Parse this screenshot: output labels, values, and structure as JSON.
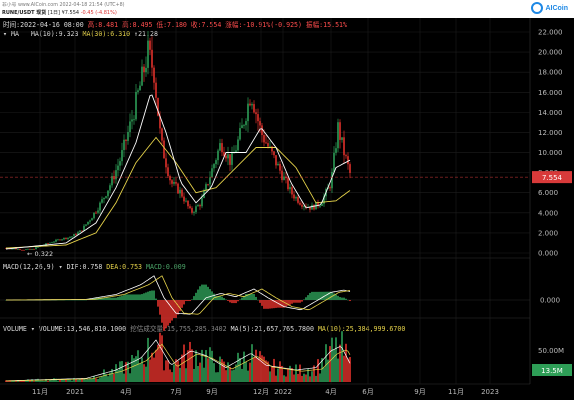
{
  "header": {
    "site": "非小号",
    "url": "www.AICoin.com",
    "timestamp": "2022-04-18 21:54 (UTC+8)",
    "pair": "RUNE/USDT 现货",
    "interval": "[1日]",
    "price": "¥7.554",
    "change": "-0.45 (-4.81%)",
    "logo_text": "AICoin"
  },
  "ohlc_bar": {
    "time": "时间:2022-04-16 08:00",
    "high": "高:8.495",
    "open": "高:8.481",
    "low": "低:7.180",
    "close": "收:7.554",
    "change": "涨幅:-10.91%(-0.925)",
    "amplitude": "振幅:15.51%"
  },
  "ma_bar": {
    "label": "MA",
    "ma10": "MA(10):9.323",
    "ma30": "MA(30):6.310",
    "extra": "↑21.28"
  },
  "macd_bar": {
    "label": "MACD(12,26,9)",
    "dif": "DIF:0.758",
    "dea": "DEA:0.753",
    "macd": "MACD:0.009"
  },
  "vol_bar": {
    "label": "VOLUME",
    "volume": "VOLUME:13,546,810.1000",
    "quote": "挖估成交量:15,755,285.3402",
    "ma5": "MA(5):21,657,765.7800",
    "ma10": "MA(10):25,384,999.6700"
  },
  "price_tag": "7.554",
  "vol_tag": "13.5M",
  "low_label": "← 0.322",
  "colors": {
    "up": "#2e9e57",
    "down": "#e0312b",
    "ma10": "#ffffff",
    "ma30": "#e6d34a",
    "grid": "#1d1d1d",
    "price_line": "#d83a3a",
    "price_tag": "#d83a3a"
  },
  "chart_data": {
    "type": "candlestick",
    "price_axis": {
      "ticks": [
        "22.000",
        "20.000",
        "18.000",
        "16.000",
        "14.000",
        "12.000",
        "10.000",
        "8.000",
        "6.000",
        "4.000",
        "2.000",
        "0.000"
      ],
      "ylim": [
        0,
        22
      ]
    },
    "macd_axis": {
      "ticks": [
        "0.000"
      ]
    },
    "vol_axis": {
      "ticks": [
        "50.00M"
      ]
    },
    "x_axis": {
      "ticks": [
        "11月",
        "2021",
        "4月",
        "7月",
        "9月",
        "12月",
        "2022",
        "4月",
        "6月",
        "9月",
        "11月",
        "2023"
      ]
    },
    "price_points": [
      {
        "x": 0,
        "y": 0.5
      },
      {
        "x": 10,
        "y": 0.4
      },
      {
        "x": 25,
        "y": 0.32
      },
      {
        "x": 40,
        "y": 0.9
      },
      {
        "x": 55,
        "y": 1.4
      },
      {
        "x": 65,
        "y": 1.6
      },
      {
        "x": 75,
        "y": 2.2
      },
      {
        "x": 85,
        "y": 3.5
      },
      {
        "x": 95,
        "y": 5.0
      },
      {
        "x": 105,
        "y": 7.0
      },
      {
        "x": 115,
        "y": 9.5
      },
      {
        "x": 125,
        "y": 13
      },
      {
        "x": 135,
        "y": 17
      },
      {
        "x": 142,
        "y": 20
      },
      {
        "x": 148,
        "y": 18
      },
      {
        "x": 155,
        "y": 11
      },
      {
        "x": 165,
        "y": 7
      },
      {
        "x": 175,
        "y": 6
      },
      {
        "x": 185,
        "y": 4
      },
      {
        "x": 195,
        "y": 5
      },
      {
        "x": 205,
        "y": 8
      },
      {
        "x": 215,
        "y": 11
      },
      {
        "x": 225,
        "y": 9
      },
      {
        "x": 235,
        "y": 12
      },
      {
        "x": 245,
        "y": 16
      },
      {
        "x": 255,
        "y": 12
      },
      {
        "x": 265,
        "y": 10
      },
      {
        "x": 275,
        "y": 8
      },
      {
        "x": 285,
        "y": 6
      },
      {
        "x": 295,
        "y": 5
      },
      {
        "x": 305,
        "y": 4.5
      },
      {
        "x": 315,
        "y": 5
      },
      {
        "x": 325,
        "y": 7
      },
      {
        "x": 332,
        "y": 12.5
      },
      {
        "x": 338,
        "y": 10
      },
      {
        "x": 345,
        "y": 7.55
      }
    ],
    "ma30_points": [
      {
        "x": 0,
        "y": 0.5
      },
      {
        "x": 60,
        "y": 0.8
      },
      {
        "x": 90,
        "y": 2
      },
      {
        "x": 110,
        "y": 5
      },
      {
        "x": 130,
        "y": 9
      },
      {
        "x": 150,
        "y": 11.5
      },
      {
        "x": 170,
        "y": 9
      },
      {
        "x": 190,
        "y": 6
      },
      {
        "x": 210,
        "y": 6.5
      },
      {
        "x": 230,
        "y": 8.5
      },
      {
        "x": 250,
        "y": 10.5
      },
      {
        "x": 270,
        "y": 10.5
      },
      {
        "x": 290,
        "y": 8.5
      },
      {
        "x": 310,
        "y": 5
      },
      {
        "x": 330,
        "y": 5.2
      },
      {
        "x": 345,
        "y": 6.3
      }
    ],
    "ma10_points": [
      {
        "x": 0,
        "y": 0.4
      },
      {
        "x": 60,
        "y": 1
      },
      {
        "x": 90,
        "y": 3
      },
      {
        "x": 110,
        "y": 6.5
      },
      {
        "x": 130,
        "y": 11
      },
      {
        "x": 145,
        "y": 16
      },
      {
        "x": 160,
        "y": 12
      },
      {
        "x": 175,
        "y": 7
      },
      {
        "x": 190,
        "y": 5
      },
      {
        "x": 205,
        "y": 6.5
      },
      {
        "x": 220,
        "y": 10
      },
      {
        "x": 240,
        "y": 10
      },
      {
        "x": 255,
        "y": 12.5
      },
      {
        "x": 270,
        "y": 10.5
      },
      {
        "x": 285,
        "y": 7
      },
      {
        "x": 300,
        "y": 4.5
      },
      {
        "x": 315,
        "y": 4.8
      },
      {
        "x": 330,
        "y": 8.5
      },
      {
        "x": 345,
        "y": 9.3
      }
    ]
  }
}
